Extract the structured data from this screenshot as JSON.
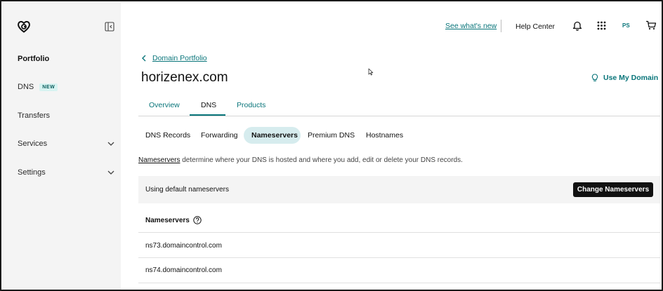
{
  "colors": {
    "accent": "#09757a",
    "sidebar_bg": "#f4f4f4",
    "badge_bg": "#d7f3f1",
    "pill_bg": "#d6ecee",
    "button_bg": "#111111"
  },
  "sidebar": {
    "items": [
      {
        "label": "Portfolio"
      },
      {
        "label": "DNS",
        "badge": "NEW"
      },
      {
        "label": "Transfers"
      },
      {
        "label": "Services"
      },
      {
        "label": "Settings"
      }
    ]
  },
  "topbar": {
    "whats_new": "See what's new",
    "help_center": "Help Center",
    "avatar_initials": "PS",
    "icons": [
      "bell-icon",
      "apps-grid-icon",
      "cart-icon"
    ]
  },
  "breadcrumb": {
    "label": "Domain Portfolio"
  },
  "page": {
    "title": "horizenex.com",
    "use_my_domain": "Use My Domain"
  },
  "tabs": [
    {
      "label": "Overview"
    },
    {
      "label": "DNS"
    },
    {
      "label": "Products"
    }
  ],
  "subtabs": [
    {
      "label": "DNS Records"
    },
    {
      "label": "Forwarding"
    },
    {
      "label": "Nameservers"
    },
    {
      "label": "Premium DNS"
    },
    {
      "label": "Hostnames"
    }
  ],
  "description": {
    "link": "Nameservers",
    "text": " determine where your DNS is hosted and where you add, edit or delete your DNS records."
  },
  "nameserver_panel": {
    "status": "Using default nameservers",
    "button": "Change Nameservers"
  },
  "nameservers": {
    "header": "Nameservers",
    "rows": [
      "ns73.domaincontrol.com",
      "ns74.domaincontrol.com"
    ]
  }
}
